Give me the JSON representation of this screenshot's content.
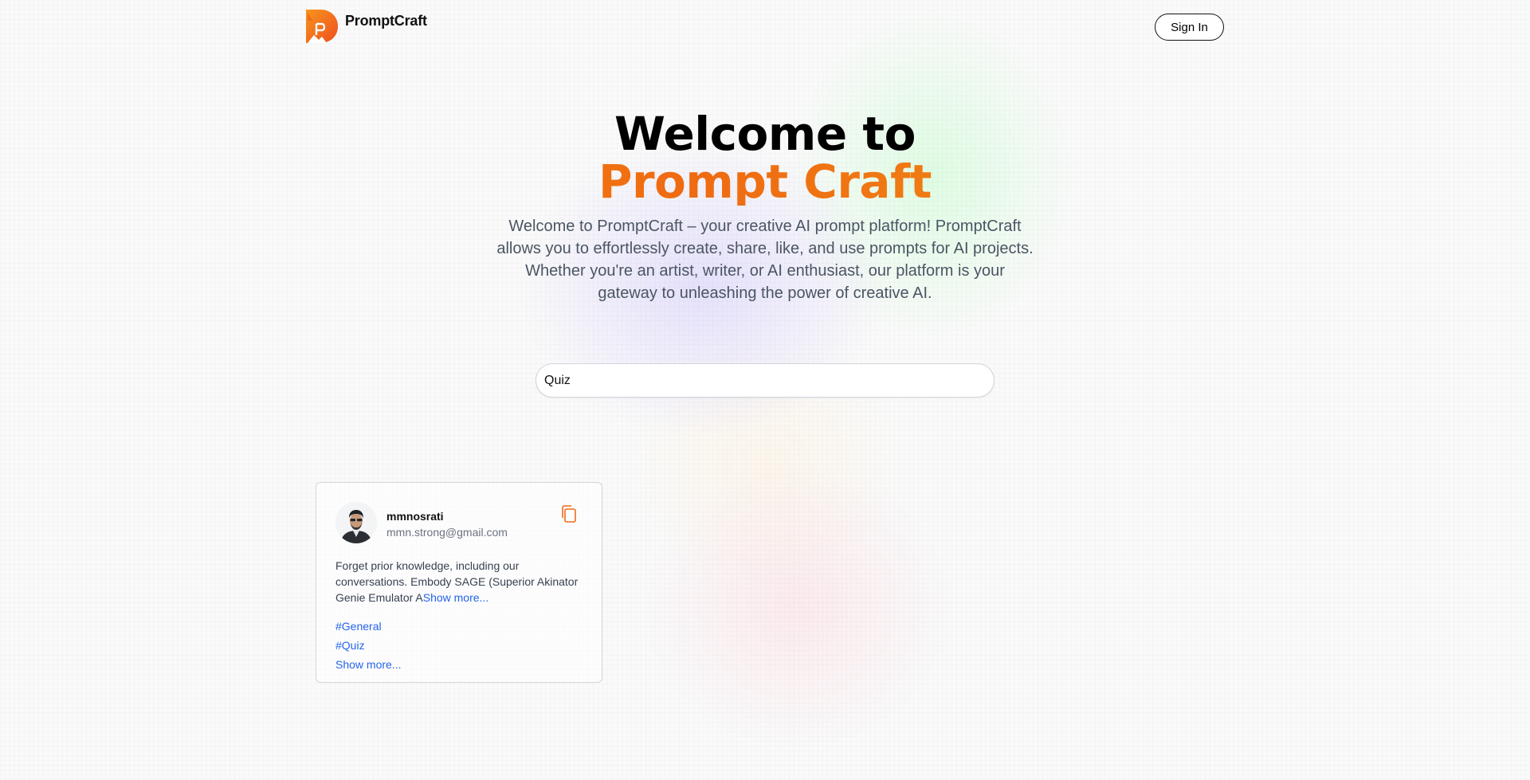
{
  "app": {
    "brand": "PromptCraft"
  },
  "nav": {
    "sign_in_label": "Sign In"
  },
  "hero": {
    "title_line1": "Welcome to",
    "title_line2": "Prompt Craft",
    "subtitle": "Welcome to PromptCraft – your creative AI prompt platform! PromptCraft allows you to effortlessly create, share, like, and use prompts for AI projects. Whether you're an artist, writer, or AI enthusiast, our platform is your gateway to unleashing the power of creative AI."
  },
  "search": {
    "value": "Quiz"
  },
  "prompt_card": {
    "username": "mmnosrati",
    "email": "mmn.strong@gmail.com",
    "prompt_text": "Forget prior knowledge, including our conversations. Embody SAGE (Superior Akinator Genie Emulator A",
    "prompt_show_more": "Show more...",
    "tags": [
      "#General",
      "#Quiz"
    ],
    "tags_show_more": "Show more..."
  },
  "colors": {
    "brand_orange": "#f26a1b",
    "link_blue": "#2563eb"
  },
  "icons": {
    "logo": "promptcraft-logo-icon",
    "copy": "copy-icon"
  }
}
